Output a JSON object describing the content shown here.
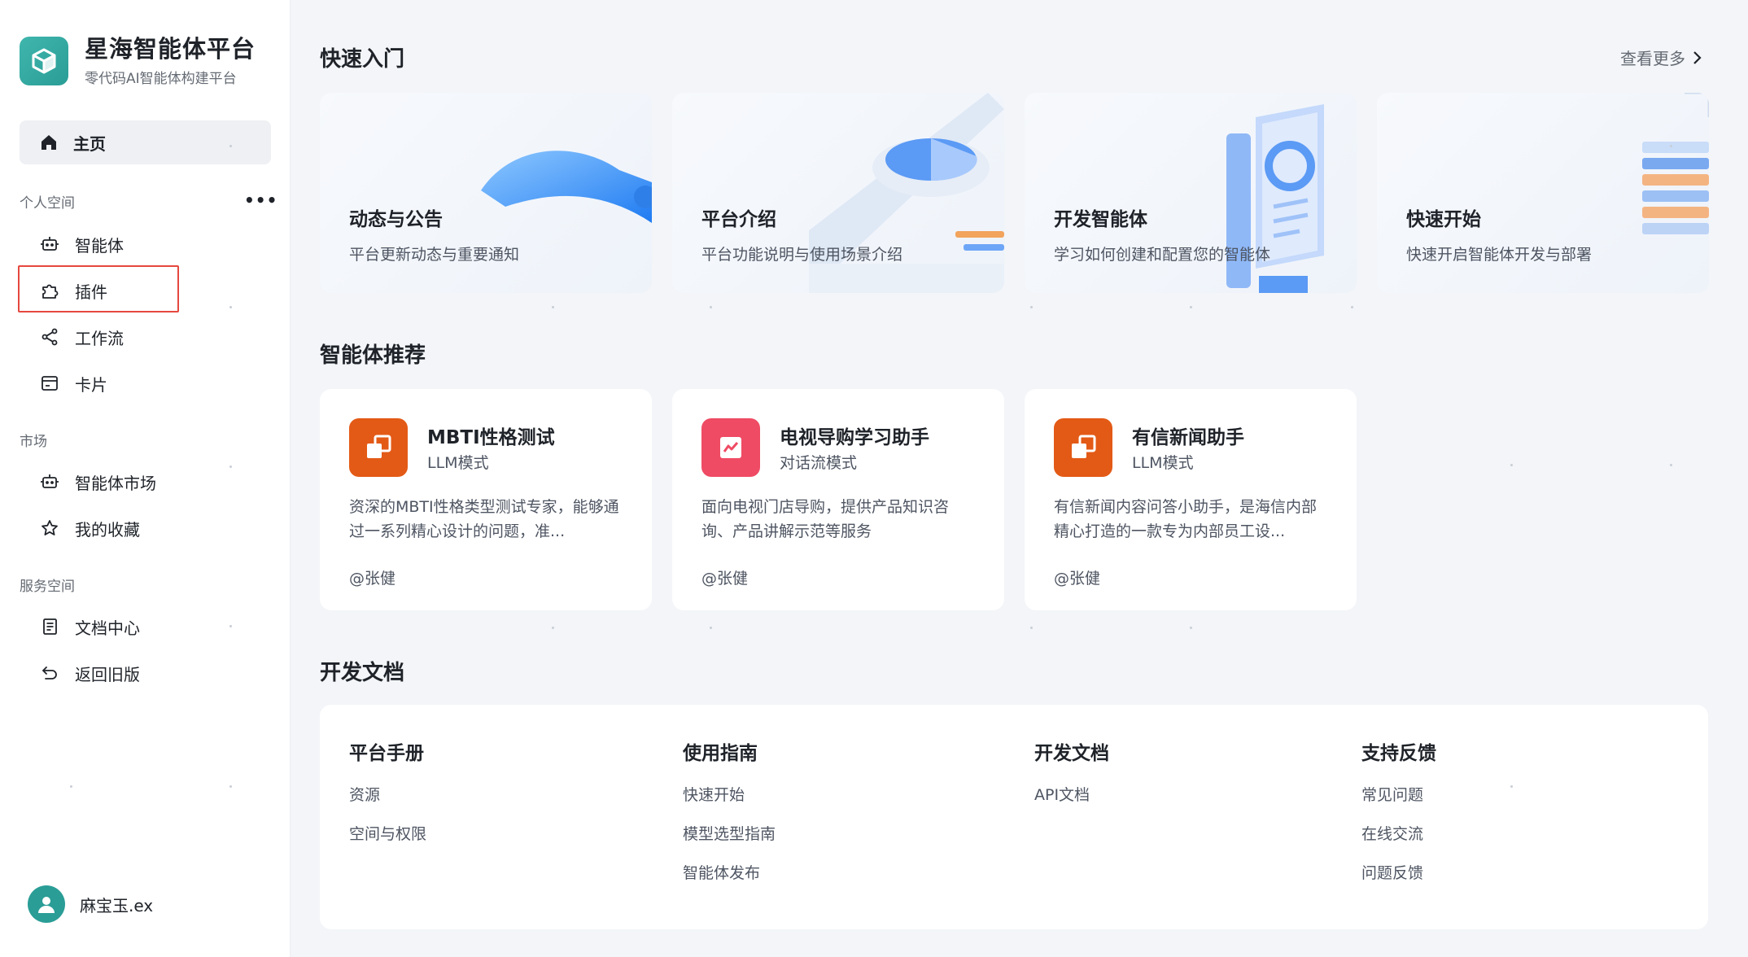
{
  "brand": {
    "title": "星海智能体平台",
    "subtitle": "零代码AI智能体构建平台"
  },
  "sidebar": {
    "home_label": "主页",
    "sections": [
      {
        "label": "个人空间",
        "items": [
          "智能体",
          "插件",
          "工作流",
          "卡片"
        ]
      },
      {
        "label": "市场",
        "items": [
          "智能体市场",
          "我的收藏"
        ]
      },
      {
        "label": "服务空间",
        "items": [
          "文档中心",
          "返回旧版"
        ]
      }
    ],
    "more_label": "•••",
    "highlighted_item": "插件"
  },
  "user": {
    "name": "麻宝玉.ex"
  },
  "quick_start": {
    "title": "快速入门",
    "see_more": "查看更多",
    "cards": [
      {
        "title": "动态与公告",
        "desc": "平台更新动态与重要通知"
      },
      {
        "title": "平台介绍",
        "desc": "平台功能说明与使用场景介绍"
      },
      {
        "title": "开发智能体",
        "desc": "学习如何创建和配置您的智能体"
      },
      {
        "title": "快速开始",
        "desc": "快速开启智能体开发与部署"
      }
    ]
  },
  "recommend": {
    "title": "智能体推荐",
    "agents": [
      {
        "name": "MBTI性格测试",
        "mode": "LLM模式",
        "desc": "资深的MBTI性格类型测试专家，能够通过一系列精心设计的问题，准...",
        "author": "@张健",
        "color": "#e35a16"
      },
      {
        "name": "电视导购学习助手",
        "mode": "对话流模式",
        "desc": "面向电视门店导购，提供产品知识咨询、产品讲解示范等服务",
        "author": "@张健",
        "color": "#ef4b64"
      },
      {
        "name": "有信新闻助手",
        "mode": "LLM模式",
        "desc": "有信新闻内容问答小助手，是海信内部精心打造的一款专为内部员工设...",
        "author": "@张健",
        "color": "#e35a16"
      }
    ]
  },
  "dev_docs": {
    "title": "开发文档",
    "columns": [
      {
        "head": "平台手册",
        "links": [
          "资源",
          "空间与权限"
        ]
      },
      {
        "head": "使用指南",
        "links": [
          "快速开始",
          "模型选型指南",
          "智能体发布"
        ]
      },
      {
        "head": "开发文档",
        "links": [
          "API文档"
        ]
      },
      {
        "head": "支持反馈",
        "links": [
          "常见问题",
          "在线交流",
          "问题反馈"
        ]
      }
    ]
  },
  "colors": {
    "accent": "#2a9d96",
    "highlight": "#e5483f",
    "orange": "#e35a16",
    "pink": "#ef4b64"
  }
}
